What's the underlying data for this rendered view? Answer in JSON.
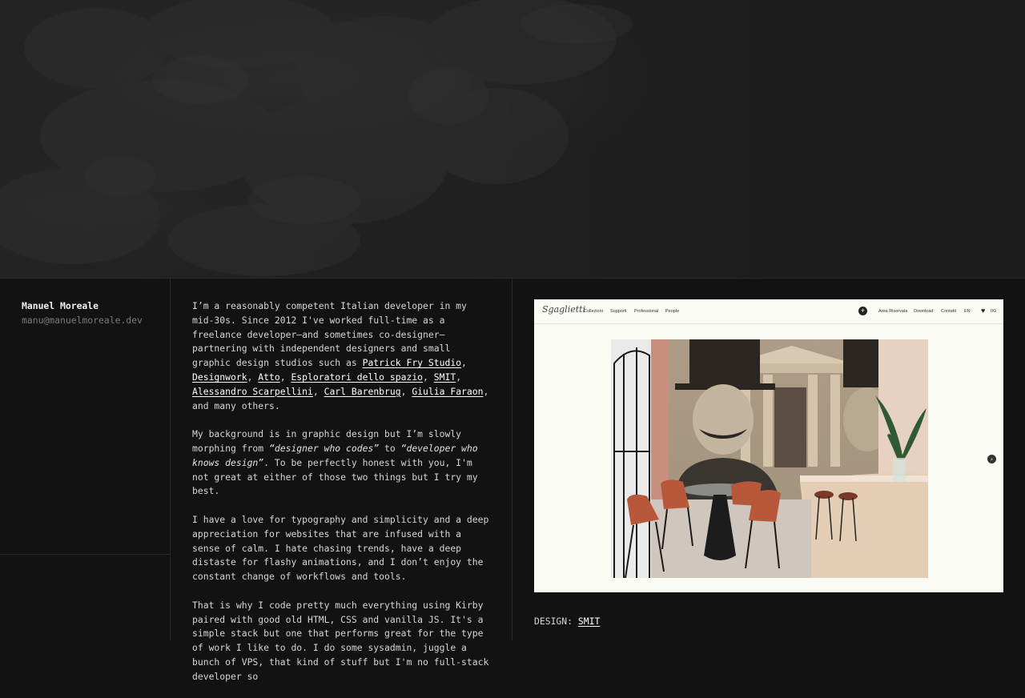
{
  "profile": {
    "name": "Manuel Moreale",
    "email": "manu@manuelmoreale.dev"
  },
  "bio": {
    "p1_intro": "I’m a reasonably competent Italian developer in my mid-30s. Since 2012 I've worked full-time as a freelance developer—and sometimes co-designer—partnering with independent designers and small graphic design studios such as ",
    "partners": [
      "Patrick Fry Studio",
      "Designwork",
      "Atto",
      "Esploratori dello spazio",
      "SMIT",
      "Alessandro Scarpellini",
      "Carl Barenbrug",
      "Giulia Faraon"
    ],
    "separator": ", ",
    "p1_outro": ", and many others.",
    "p2_start": "My background is in graphic design but I’m slowly morphing from ",
    "p2_em1": "“designer who codes”",
    "p2_to": " to ",
    "p2_em2": "“developer who knows design”",
    "p2_end": ". To be perfectly honest with you, I'm not great at either of those two things but I try my best.",
    "p3": "I have a love for typography and simplicity and a deep appreciation for websites that are infused with a sense of calm. I hate chasing trends, have a deep distaste for flashy animations, and I don’t enjoy the constant change of workflows and tools.",
    "p4": "That is why I code pretty much everything using Kirby paired with good old HTML, CSS and vanilla JS. It's a simple stack but one that performs great for the type of work I like to do. I do some sysadmin, juggle a bunch of VPS, that kind of stuff but I'm no full-stack developer so"
  },
  "project": {
    "screenshot": {
      "logo_text": "Sgaglietti",
      "nav_left": [
        "Collezioni",
        "Supporti",
        "Professional",
        "People"
      ],
      "nav_right": [
        "Area Riservata",
        "Download",
        "Contatti",
        "EN"
      ],
      "fav_count": "0G"
    },
    "caption_label": "DESIGN:",
    "caption_link": "SMIT"
  },
  "colors": {
    "background": "#121212",
    "text": "#d6d6d6",
    "link": "#ffffff",
    "muted": "#7a7a7a",
    "divider": "#2a2a2a"
  }
}
